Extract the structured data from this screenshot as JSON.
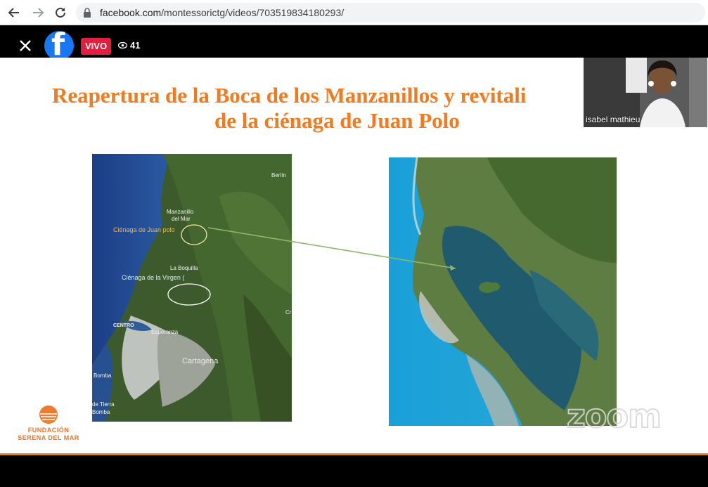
{
  "browser": {
    "url_host": "facebook.com",
    "url_path": "/montessorictg/videos/703519834180293/",
    "back_icon": "arrow-left-icon",
    "forward_icon": "arrow-right-icon",
    "reload_icon": "reload-icon",
    "lock_icon": "lock-icon"
  },
  "live": {
    "close_icon": "close-icon",
    "logo_icon": "facebook-logo-icon",
    "badge": "VIVO",
    "viewer_icon": "eye-icon",
    "viewers": "41",
    "badge_color": "#e41e3f",
    "brand_color": "#1877f2"
  },
  "slide": {
    "title_line1": "Reapertura de la Boca de los Manzanillos y revitali",
    "title_line2": "de la ciénaga de Juan Polo",
    "title_color": "#f47a20",
    "left_map_labels": {
      "berlin": "Berlín",
      "manzanillo_1": "Manzanillo",
      "manzanillo_2": "del Mar",
      "cienaga_juan_polo": "Ciénaga de Juan polo",
      "la_boquilla": "La Boquilla",
      "cienaga_virgen": "Ciénaga de la Virgen (",
      "centro": "CENTRO",
      "esperanza": "Esperanza",
      "cartagena": "Cartagena",
      "bomba1": "Bomba",
      "tierra": "de Tierra",
      "bomba2": "Bomba",
      "edge_c": "Cr"
    },
    "foundation_name_1": "FUNDACIÓN",
    "foundation_name_2": "SERENA DEL MAR",
    "foundation_color": "#e8752a"
  },
  "webcam": {
    "participant_name": "isabel mathieu"
  },
  "zoom_watermark": "zoom"
}
